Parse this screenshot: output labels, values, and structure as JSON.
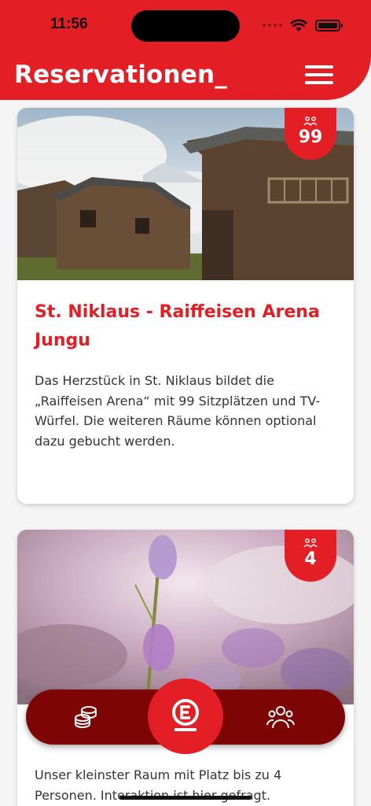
{
  "status": {
    "time": "11:56"
  },
  "header": {
    "title": "Reservationen_"
  },
  "cards": [
    {
      "capacity": "99",
      "title": "St. Niklaus - Raiffeisen Arena Jungu",
      "description": "Das Herzstück in St. Niklaus bildet die „Raiffeisen Arena“ mit 99 Sitzplätzen und TV-Würfel. Die weiteren Räume können optional dazu gebucht werden."
    },
    {
      "capacity": "4",
      "description": "Unser kleinster Raum mit Platz bis zu 4 Personen. Interaktion ist hier gefragt."
    }
  ],
  "bottom_nav": {
    "icons": [
      "coins-icon",
      "brand-logo-icon",
      "people-icon"
    ]
  },
  "colors": {
    "brand_red": "#e31e25",
    "nav_dark": "#7e0506"
  }
}
